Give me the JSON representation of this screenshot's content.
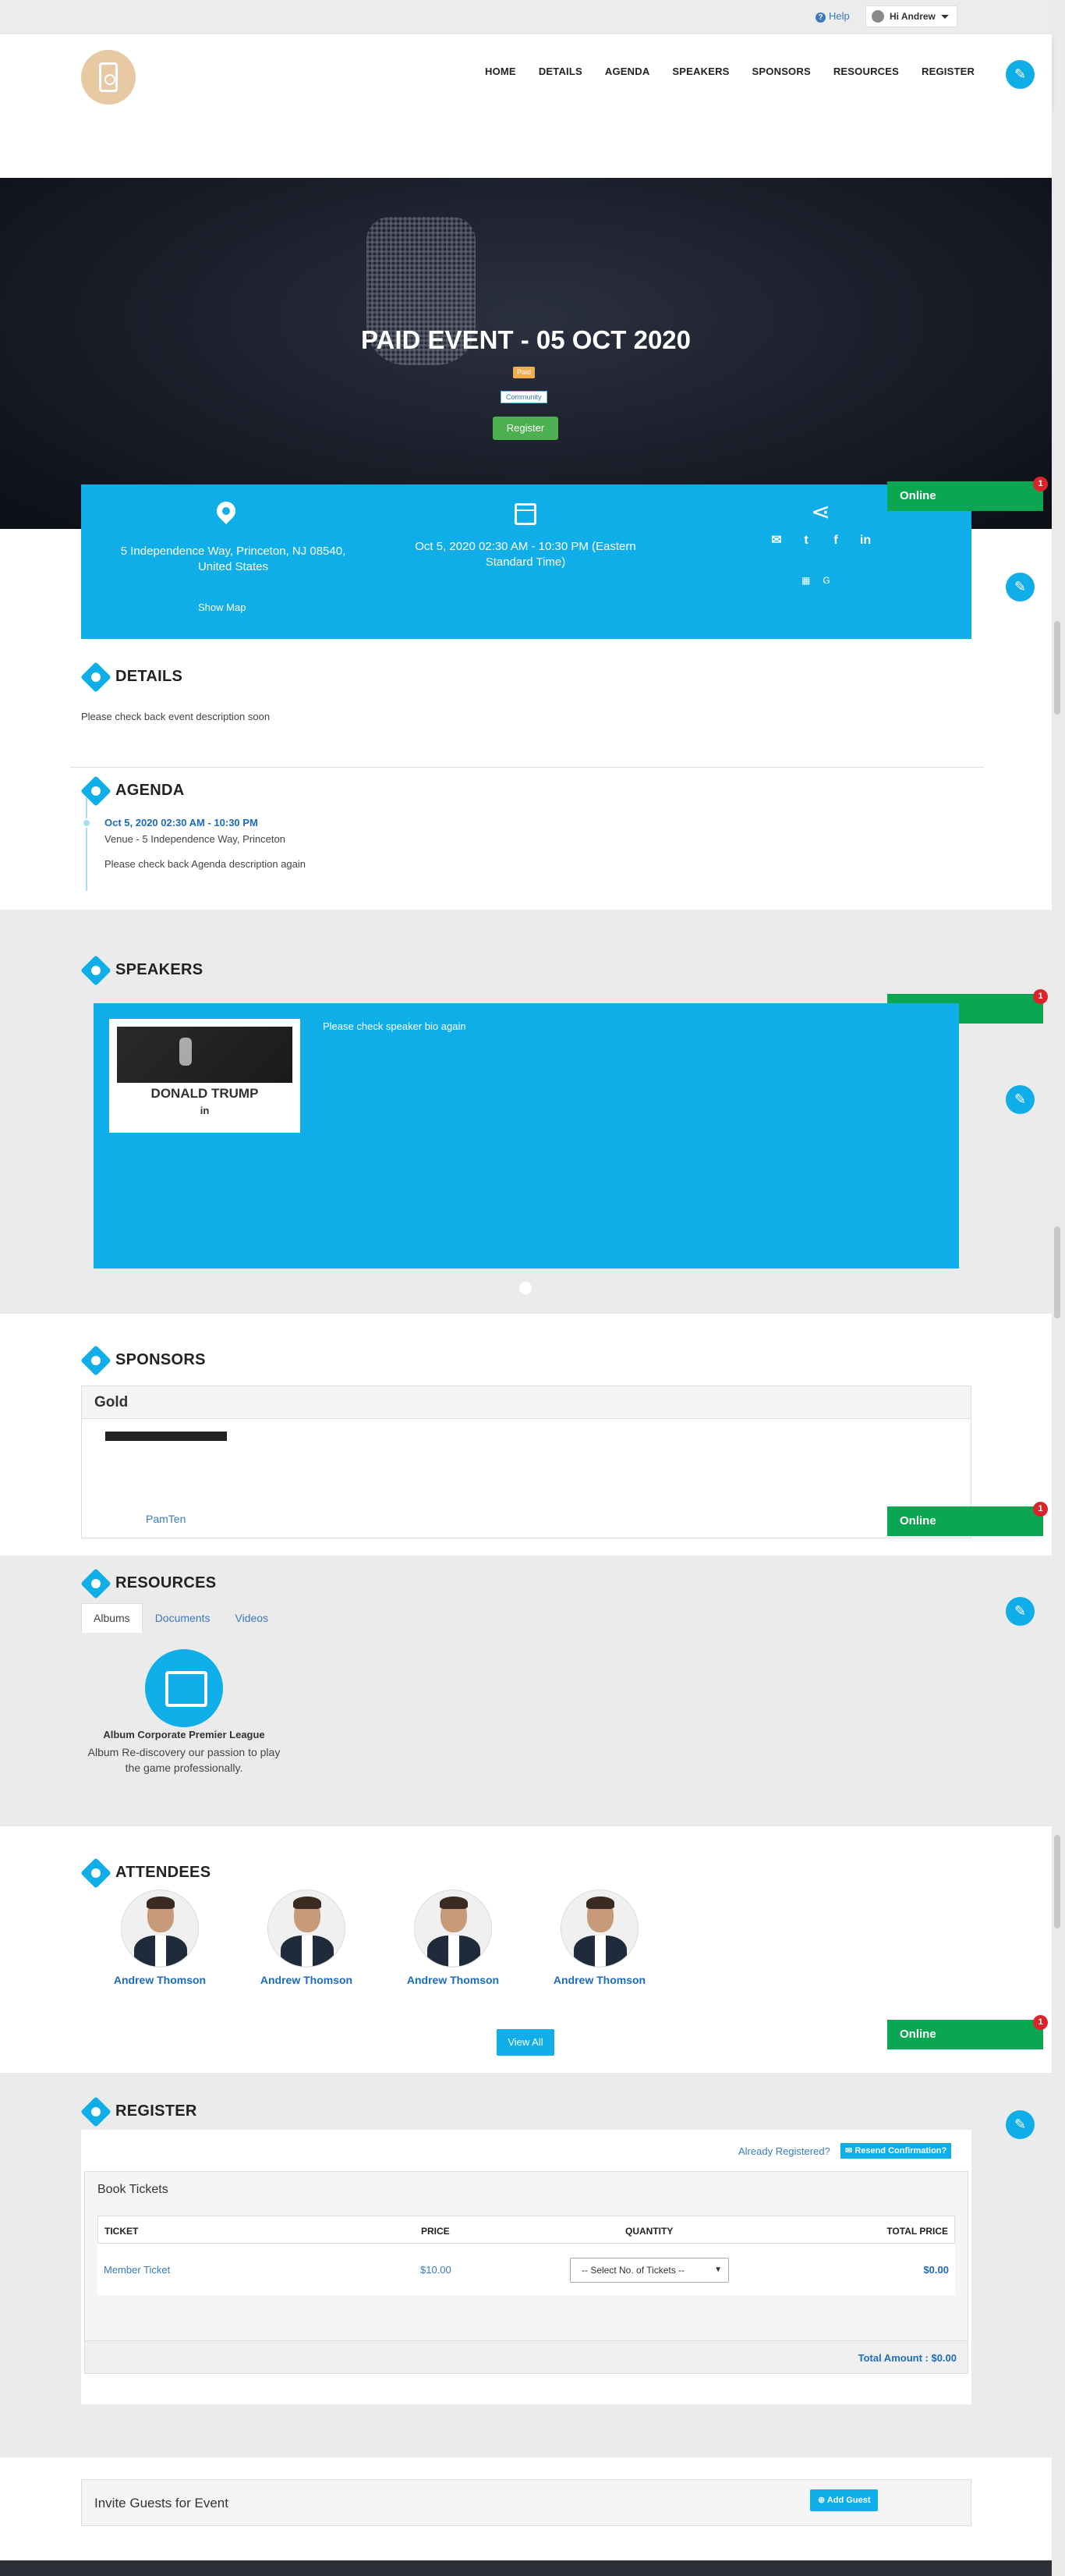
{
  "topbar": {
    "help": "Help",
    "user": "Hi Andrew"
  },
  "nav": [
    "HOME",
    "DETAILS",
    "AGENDA",
    "SPEAKERS",
    "SPONSORS",
    "RESOURCES",
    "REGISTER"
  ],
  "hero": {
    "title": "PAID EVENT - 05 OCT 2020",
    "badge_paid": "Paid",
    "badge_type": "Community",
    "register": "Register"
  },
  "info": {
    "address": "5 Independence Way, Princeton, NJ 08540, United States",
    "show_map": "Show Map",
    "datetime": "Oct 5, 2020 02:30 AM - 10:30 PM (Eastern Standard Time)"
  },
  "online": {
    "label": "Online",
    "count": "1"
  },
  "details": {
    "title": "DETAILS",
    "text": "Please check back event description soon"
  },
  "agenda": {
    "title": "AGENDA",
    "time": "Oct 5, 2020 02:30 AM - 10:30 PM",
    "venue": "Venue - 5 Independence Way, Princeton",
    "desc": "Please check back Agenda description again"
  },
  "speakers": {
    "title": "SPEAKERS",
    "name": "DONALD TRUMP",
    "social": "in",
    "bio": "Please check speaker bio again"
  },
  "sponsors": {
    "title": "SPONSORS",
    "tier": "Gold",
    "link": "PamTen"
  },
  "resources": {
    "title": "RESOURCES",
    "tabs": [
      "Albums",
      "Documents",
      "Videos"
    ],
    "album_title": "Album Corporate Premier League",
    "album_desc": "Album Re-discovery our passion to play the game professionally."
  },
  "attendees": {
    "title": "ATTENDEES",
    "names": [
      "Andrew Thomson",
      "Andrew Thomson",
      "Andrew Thomson",
      "Andrew Thomson"
    ],
    "view_all": "View All"
  },
  "register": {
    "title": "REGISTER",
    "already": "Already Registered?",
    "resend": "✉ Resend Confirmation?",
    "book": "Book Tickets",
    "headers": [
      "TICKET",
      "PRICE",
      "QUANTITY",
      "TOTAL PRICE"
    ],
    "ticket": "Member Ticket",
    "price": "$10.00",
    "select": "-- Select No. of Tickets --",
    "row_total": "$0.00",
    "total": "Total Amount : $0.00"
  },
  "invite": {
    "title": "Invite Guests for Event",
    "add": "⊕ Add Guest"
  }
}
